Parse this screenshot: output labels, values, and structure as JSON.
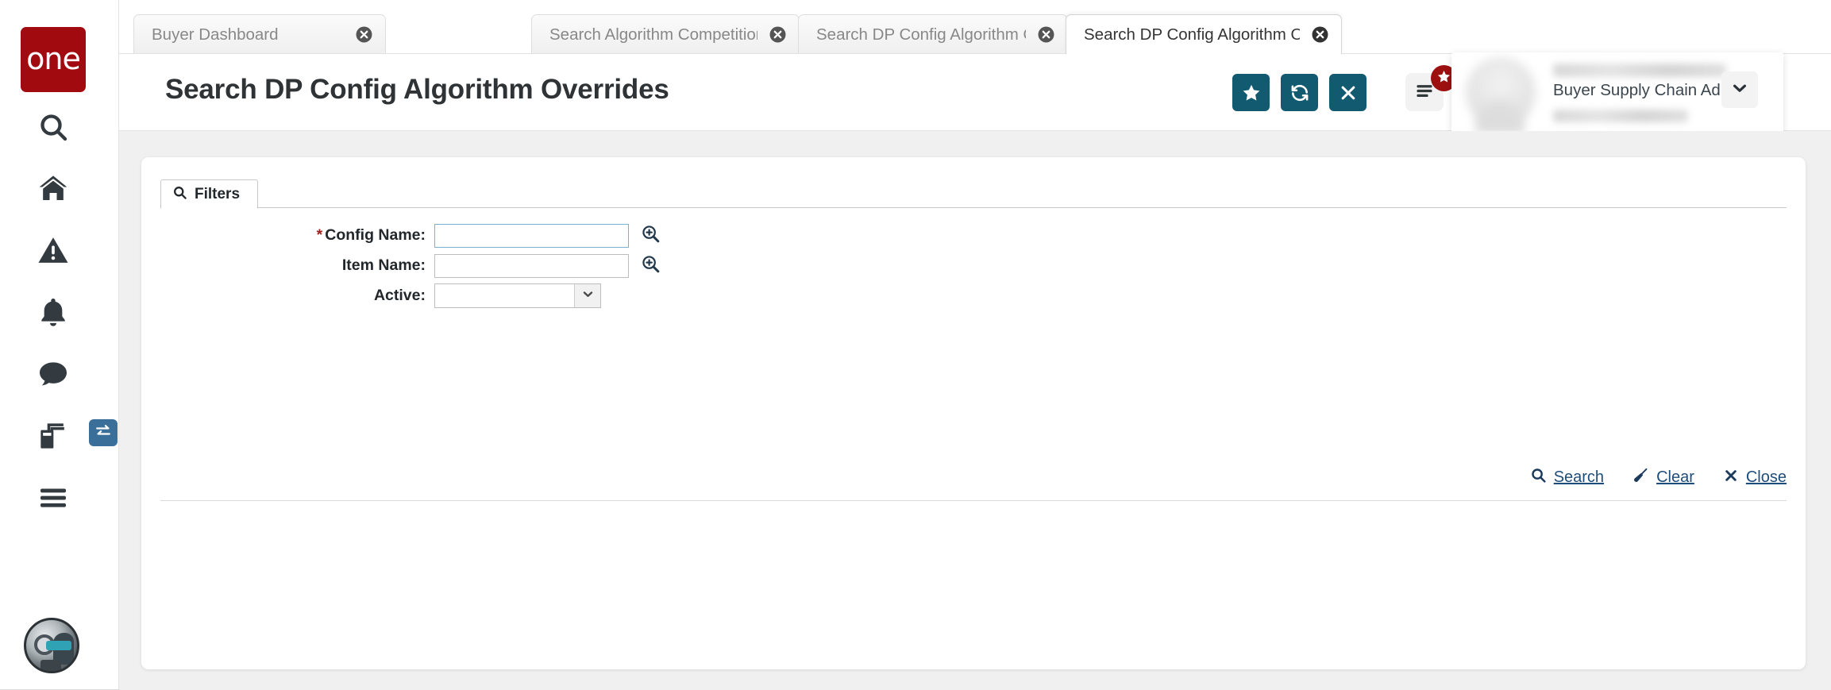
{
  "app": {
    "logo_text": "one",
    "logo_color": "#a10b10",
    "accent_teal": "#115a70",
    "link_color": "#1f4d7a",
    "required_color": "#9e2020"
  },
  "sidebar": {
    "items": [
      {
        "name": "search-icon",
        "label": "Search"
      },
      {
        "name": "home-icon",
        "label": "Home"
      },
      {
        "name": "warning-icon",
        "label": "Issues"
      },
      {
        "name": "bell-icon",
        "label": "Notifications"
      },
      {
        "name": "chat-icon",
        "label": "Messages"
      },
      {
        "name": "cards-icon",
        "label": "Workspaces"
      },
      {
        "name": "hamburger-icon",
        "label": "Menu"
      }
    ],
    "exchange_badge": {
      "name": "exchange-arrows-icon",
      "color": "#3a6f9a"
    },
    "assistant": {
      "name": "ai-assistant-avatar",
      "label": "Assistant"
    }
  },
  "tabs": [
    {
      "label": "Buyer Dashboard",
      "active": false
    },
    {
      "label": "Search Algorithm Competition C...",
      "active": false
    },
    {
      "label": "Search DP Config Algorithm Ove...",
      "active": false
    },
    {
      "label": "Search DP Config Algorithm Ove...",
      "active": true
    }
  ],
  "header": {
    "title": "Search DP Config Algorithm Overrides",
    "buttons": [
      {
        "name": "favorite-button",
        "icon": "star-icon",
        "label": "Favorite"
      },
      {
        "name": "refresh-button",
        "icon": "refresh-icon",
        "label": "Refresh"
      },
      {
        "name": "close-page-button",
        "icon": "close-icon",
        "label": "Close"
      }
    ],
    "menu_button": {
      "icon": "menu-lines-icon",
      "label": "Menu"
    },
    "menu_badge_icon": "star-icon",
    "user": {
      "name": "",
      "role": "Buyer Supply Chain Admin",
      "email": "",
      "chevron_icon": "chevron-down-icon"
    }
  },
  "filters": {
    "tab_label": "Filters",
    "tab_icon": "search-icon",
    "fields": [
      {
        "label": "Config Name:",
        "required": true,
        "type": "text",
        "value": "",
        "placeholder": "",
        "focused": true,
        "lookup_icon": "magnifier-plus-icon"
      },
      {
        "label": "Item Name:",
        "required": false,
        "type": "text",
        "value": "",
        "placeholder": "",
        "focused": false,
        "lookup_icon": "magnifier-plus-icon"
      },
      {
        "label": "Active:",
        "required": false,
        "type": "select",
        "value": "",
        "options": [],
        "chevron_icon": "chevron-down-icon"
      }
    ],
    "actions": [
      {
        "label": "Search",
        "icon": "search-icon"
      },
      {
        "label": "Clear",
        "icon": "broom-icon"
      },
      {
        "label": "Close",
        "icon": "x-icon"
      }
    ]
  }
}
